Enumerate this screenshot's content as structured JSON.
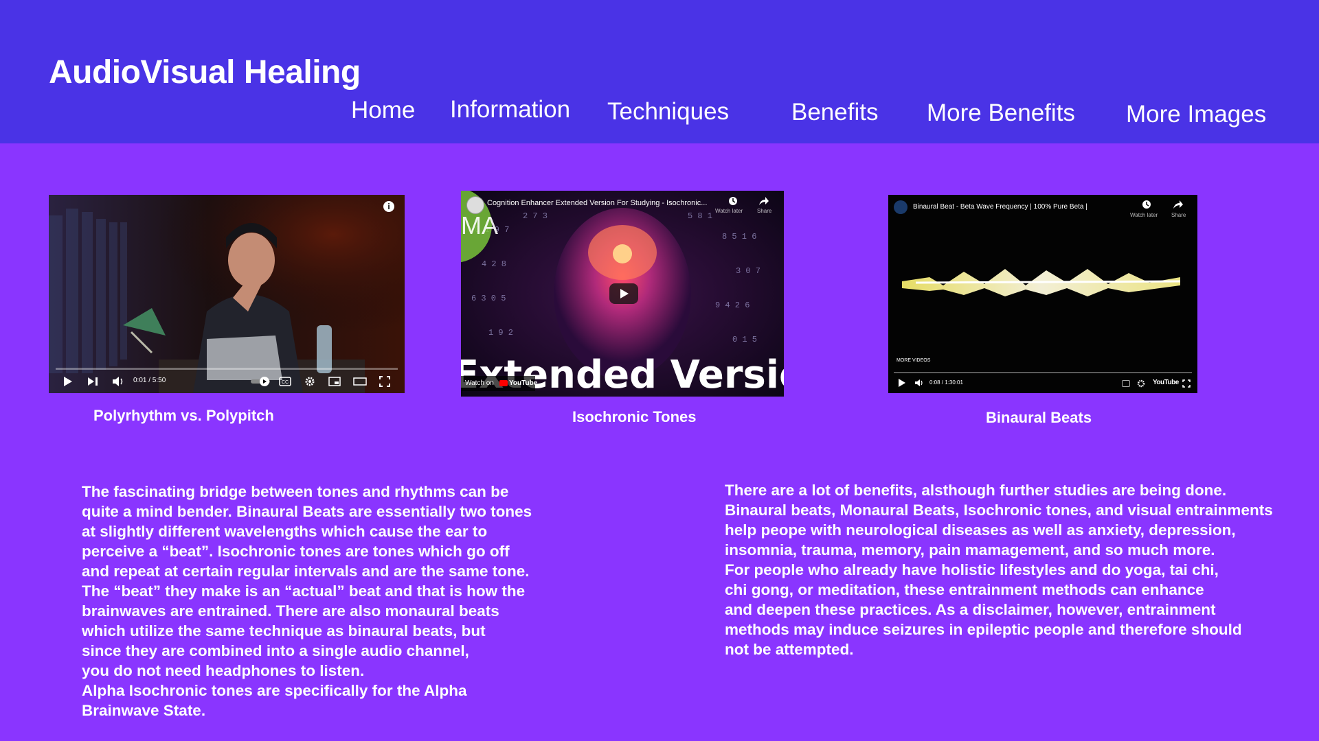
{
  "header": {
    "title": "AudioVisual Healing",
    "bg": "#4a33e6",
    "nav": [
      "Home",
      "Information",
      "Techniques",
      "Benefits",
      "More Benefits",
      "More Images"
    ]
  },
  "page_bg": "#8a35ff",
  "videos": [
    {
      "caption": "Polyrhythm vs. Polypitch",
      "time": "0:01 / 5:50",
      "progress": 0.003
    },
    {
      "caption": "Isochronic Tones",
      "overlay_title": "Cognition Enhancer Extended Version For Studying - Isochronic...",
      "watch_later": "Watch later",
      "share": "Share",
      "big_text": "Extended Version",
      "watch_on": "Watch on",
      "youtube": "YouTube",
      "channel_badge": "MA"
    },
    {
      "caption": "Binaural Beats",
      "overlay_title": "Binaural Beat - Beta Wave Frequency | 100% Pure Beta |",
      "watch_later": "Watch later",
      "share": "Share",
      "more_videos": "MORE VIDEOS",
      "time": "0:08 / 1:30:01",
      "youtube": "YouTube",
      "progress": 0.002
    }
  ],
  "left_paragraphs": [
    "The fascinating bridge between tones and rhythms can be",
    "quite a mind bender. Binaural Beats are essentially two tones",
    "at slightly different wavelengths which cause the ear to",
    "perceive a “beat”. Isochronic tones are tones which go off",
    "and repeat at certain regular intervals and are the same tone.",
    "The “beat” they make is an “actual” beat and that is how the",
    "brainwaves are entrained. There are also monaural beats",
    "which utilize the same technique as binaural beats, but",
    "since they are combined into a single audio channel,",
    "you do not need headphones to listen.",
    "Alpha Isochronic tones are specifically for the Alpha",
    "Brainwave State."
  ],
  "right_paragraphs": [
    "There are a lot of benefits, alsthough further studies are being done.",
    "Binaural beats, Monaural Beats, Isochronic tones, and visual entrainments",
    "help peope with neurological diseases as well as anxiety, depression,",
    "insomnia, trauma, memory, pain mamagement, and so much more.",
    "For people who already have holistic lifestyles and do yoga, tai chi,",
    "chi gong, or meditation, these entrainment methods can enhance",
    "and deepen these practices. As a disclaimer, however, entrainment",
    "methods may induce seizures in epileptic people and therefore should",
    "not be attempted."
  ]
}
